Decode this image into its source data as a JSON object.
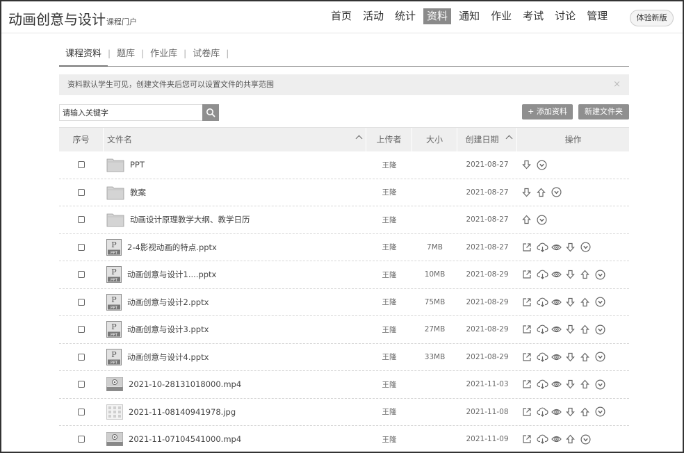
{
  "header": {
    "logo_main": "动画创意与设计",
    "logo_sub": "课程门户",
    "nav": [
      {
        "label": "首页"
      },
      {
        "label": "活动"
      },
      {
        "label": "统计"
      },
      {
        "label": "资料",
        "active": true
      },
      {
        "label": "通知"
      },
      {
        "label": "作业"
      },
      {
        "label": "考试"
      },
      {
        "label": "讨论"
      },
      {
        "label": "管理"
      }
    ],
    "try_new": "体验新版"
  },
  "tabs": [
    {
      "label": "课程资料",
      "active": true
    },
    {
      "label": "题库"
    },
    {
      "label": "作业库"
    },
    {
      "label": "试卷库"
    }
  ],
  "notice": {
    "text": "资料默认学生可见，创建文件夹后您可以设置文件的共享范围",
    "close": "×"
  },
  "search": {
    "placeholder": "请输入关键字"
  },
  "actions": {
    "add": "+ 添加资料",
    "new_folder": "新建文件夹"
  },
  "table": {
    "headers": {
      "index": "序号",
      "name": "文件名",
      "uploader": "上传者",
      "size": "大小",
      "date": "创建日期",
      "ops": "操作"
    },
    "rows": [
      {
        "type": "folder",
        "name": "PPT",
        "uploader": "王隆",
        "size": "",
        "date": "2021-08-27",
        "ops": [
          "down-arrow-icon",
          "more-circle-icon"
        ]
      },
      {
        "type": "folder",
        "name": "教案",
        "uploader": "王隆",
        "size": "",
        "date": "2021-08-27",
        "ops": [
          "down-arrow-icon",
          "up-arrow-icon",
          "more-circle-icon"
        ]
      },
      {
        "type": "folder",
        "name": "动画设计原理教学大纲、教学日历",
        "uploader": "王隆",
        "size": "",
        "date": "2021-08-27",
        "ops": [
          "up-arrow-icon",
          "more-circle-icon"
        ]
      },
      {
        "type": "ppt",
        "name": "2-4影视动画的特点.pptx",
        "uploader": "王隆",
        "size": "7MB",
        "date": "2021-08-27",
        "ops": [
          "share-icon",
          "cloud-download-icon",
          "eye-icon",
          "down-arrow-icon",
          "more-circle-icon"
        ]
      },
      {
        "type": "ppt",
        "name": "动画创意与设计1....pptx",
        "uploader": "王隆",
        "size": "10MB",
        "date": "2021-08-29",
        "ops": [
          "share-icon",
          "cloud-download-icon",
          "eye-icon",
          "down-arrow-icon",
          "up-arrow-icon",
          "more-circle-icon"
        ]
      },
      {
        "type": "ppt",
        "name": "动画创意与设计2.pptx",
        "uploader": "王隆",
        "size": "75MB",
        "date": "2021-08-29",
        "ops": [
          "share-icon",
          "cloud-download-icon",
          "eye-icon",
          "down-arrow-icon",
          "up-arrow-icon",
          "more-circle-icon"
        ]
      },
      {
        "type": "ppt",
        "name": "动画创意与设计3.pptx",
        "uploader": "王隆",
        "size": "27MB",
        "date": "2021-08-29",
        "ops": [
          "share-icon",
          "cloud-download-icon",
          "eye-icon",
          "down-arrow-icon",
          "up-arrow-icon",
          "more-circle-icon"
        ]
      },
      {
        "type": "ppt",
        "name": "动画创意与设计4.pptx",
        "uploader": "王隆",
        "size": "33MB",
        "date": "2021-08-29",
        "ops": [
          "share-icon",
          "cloud-download-icon",
          "eye-icon",
          "down-arrow-icon",
          "up-arrow-icon",
          "more-circle-icon"
        ]
      },
      {
        "type": "mp4",
        "name": "2021-10-28131018000.mp4",
        "uploader": "王隆",
        "size": "",
        "date": "2021-11-03",
        "ops": [
          "share-icon",
          "cloud-download-icon",
          "eye-icon",
          "down-arrow-icon",
          "up-arrow-icon",
          "more-circle-icon"
        ]
      },
      {
        "type": "jpg",
        "name": "2021-11-08140941978.jpg",
        "uploader": "王隆",
        "size": "",
        "date": "2021-11-08",
        "ops": [
          "share-icon",
          "cloud-download-icon",
          "eye-icon",
          "down-arrow-icon",
          "up-arrow-icon",
          "more-circle-icon"
        ]
      },
      {
        "type": "mp4",
        "name": "2021-11-07104541000.mp4",
        "uploader": "王隆",
        "size": "",
        "date": "2021-11-09",
        "ops": [
          "share-icon",
          "cloud-download-icon",
          "eye-icon",
          "up-arrow-icon",
          "more-circle-icon"
        ]
      }
    ]
  },
  "colors": {
    "accent": "#8f8f8f",
    "text": "#333333",
    "muted": "#666666",
    "header_bg": "#efefef"
  }
}
